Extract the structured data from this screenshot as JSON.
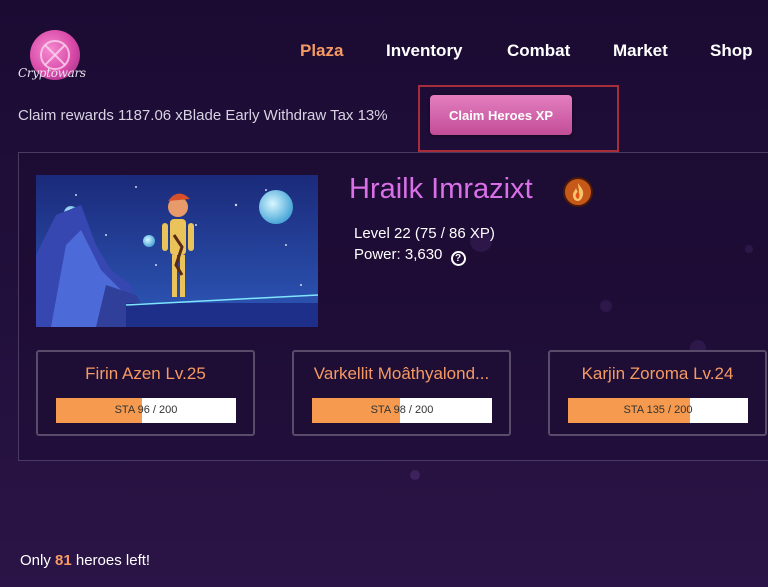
{
  "logo": {
    "text": "Cryptowars"
  },
  "nav": {
    "items": [
      "Plaza",
      "Inventory",
      "Combat",
      "Market",
      "Shop"
    ],
    "active": "Plaza"
  },
  "claim": {
    "text": "Claim rewards 1187.06 xBlade Early Withdraw Tax 13%",
    "button_label": "Claim Heroes XP"
  },
  "hero": {
    "name": "Hrailk Imrazixt",
    "element_icon": "fire-icon",
    "level_text": "Level 22 (75 / 86 XP)",
    "power_text": "Power: 3,630",
    "help_glyph": "?"
  },
  "party": [
    {
      "name": "Firin Azen Lv.25",
      "sta_text": "STA 96 / 200",
      "sta_fraction": 0.48
    },
    {
      "name": "Varkellit Moâthyalond...",
      "sta_text": "STA 98 / 200",
      "sta_fraction": 0.49
    },
    {
      "name": "Karjin Zoroma Lv.24",
      "sta_text": "STA 135 / 200",
      "sta_fraction": 0.675
    }
  ],
  "footer": {
    "prefix": "Only",
    "count": "81",
    "suffix": "heroes left!"
  },
  "colors": {
    "accent": "#f59a63",
    "hero_name": "#d970e8",
    "button": "#d865ad",
    "highlight_border": "#a72d3b"
  }
}
